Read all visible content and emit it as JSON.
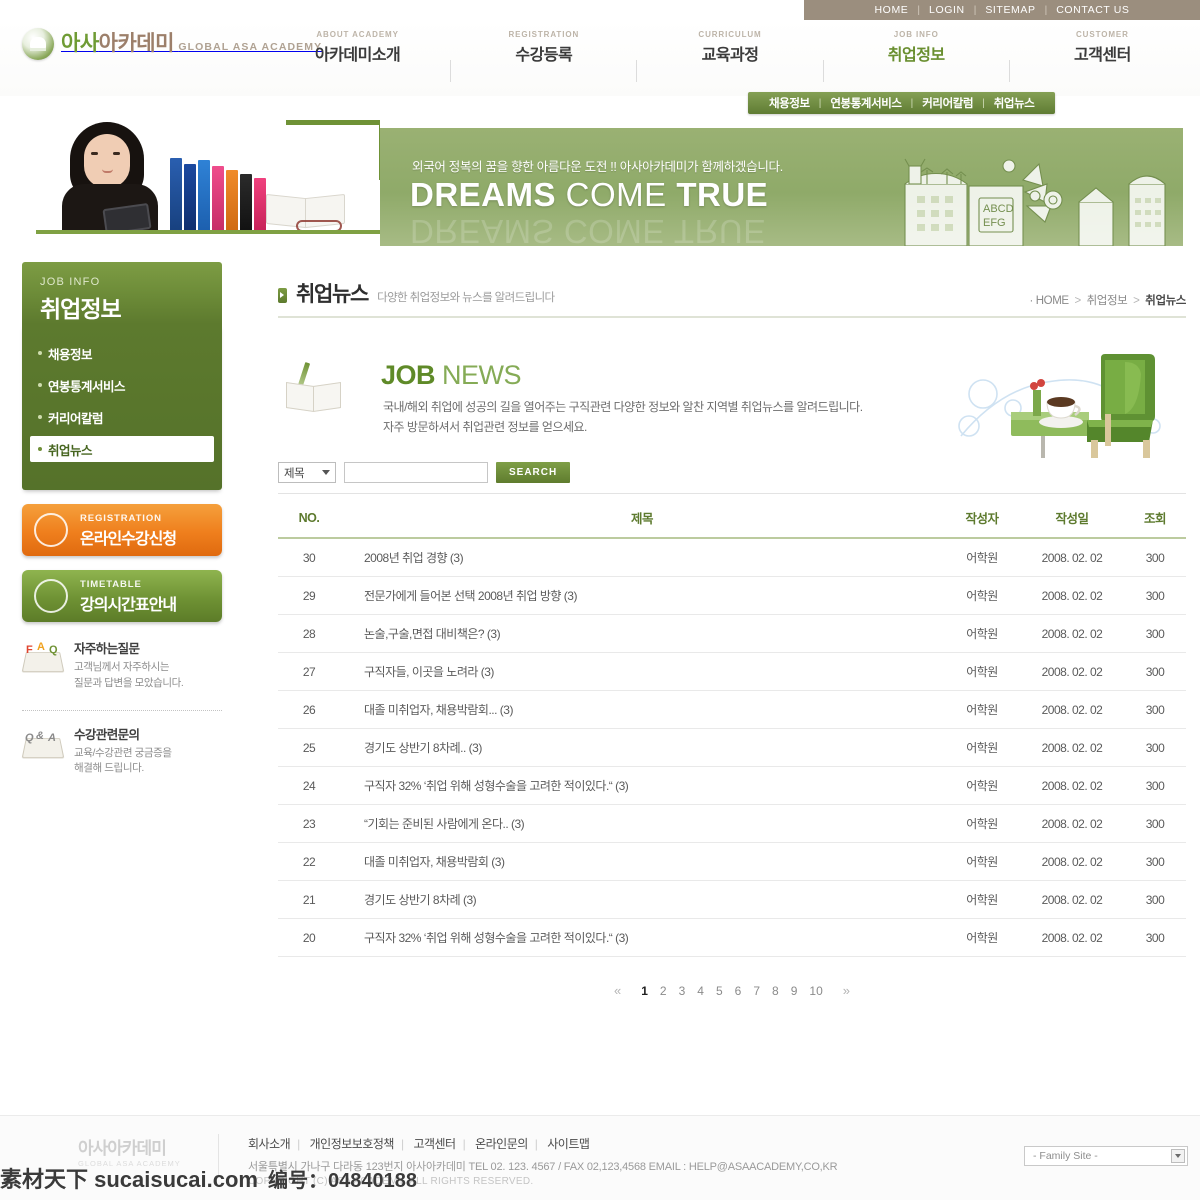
{
  "utility_nav": [
    "HOME",
    "LOGIN",
    "SITEMAP",
    "CONTACT US"
  ],
  "brand": {
    "kr_part1": "아사",
    "kr_part2": "아카데미",
    "en": "GLOBAL ASA ACADEMY",
    "icon": "academy-crest-icon"
  },
  "gnb": [
    {
      "en": "ABOUT ACADEMY",
      "kr": "아카데미소개",
      "active": false
    },
    {
      "en": "REGISTRATION",
      "kr": "수강등록",
      "active": false
    },
    {
      "en": "CURRICULUM",
      "kr": "교육과정",
      "active": false
    },
    {
      "en": "JOB INFO",
      "kr": "취업정보",
      "active": true
    },
    {
      "en": "CUSTOMER",
      "kr": "고객센터",
      "active": false
    }
  ],
  "subnav": [
    "채용정보",
    "연봉통계서비스",
    "커리어칼럼",
    "취업뉴스"
  ],
  "visual": {
    "tagline": "외국어 정복의 꿈을 향한 아름다운 도전 !!  아사아카데미가 함께하겠습니다.",
    "headline_bold": "DREAMS",
    "headline_light": " COME ",
    "headline_bold2": "TRUE",
    "headline_full": "DREAMS COME TRUE",
    "photo_alt": "student-with-books-photo",
    "illustration_alt": "city-books-illustration"
  },
  "sidebar": {
    "en": "JOB INFO",
    "kr": "취업정보",
    "items": [
      {
        "label": "채용정보",
        "active": false
      },
      {
        "label": "연봉통계서비스",
        "active": false
      },
      {
        "label": "커리어칼럼",
        "active": false
      },
      {
        "label": "취업뉴스",
        "active": true
      }
    ],
    "banners": [
      {
        "en": "REGISTRATION",
        "kr": "온라인수강신청",
        "style": "orange",
        "icon": "registration-form-icon"
      },
      {
        "en": "TIMETABLE",
        "kr": "강의시간표안내",
        "style": "green",
        "icon": "open-book-icon"
      }
    ],
    "help": [
      {
        "icon": "faq-icon",
        "title": "자주하는질문",
        "desc_line1": "고객님께서 자주하시는",
        "desc_line2": "질문과 답변을 모았습니다."
      },
      {
        "icon": "qna-icon",
        "title": "수강관련문의",
        "desc_line1": "교육/수강관련 궁금증을",
        "desc_line2": "해결해 드립니다."
      }
    ]
  },
  "page": {
    "title": "취업뉴스",
    "subtitle": "다양한 취업정보와 뉴스를 알려드립니다",
    "breadcrumb": {
      "home": "HOME",
      "section": "취업정보",
      "current": "취업뉴스"
    }
  },
  "jobnews": {
    "title_bold": "JOB",
    "title_light": " NEWS",
    "desc_line1": "국내/해외 취업에 성공의 길을 열어주는 구직관련 다양한 정보와 알찬 지역별 취업뉴스를 알려드립니다.",
    "desc_line2": "자주 방문하셔서 취업관련 정보를 얻으세요.",
    "icon": "book-people-icon",
    "illustration": "green-chair-table-coffee-illustration"
  },
  "search": {
    "select_value": "제목",
    "input_value": "",
    "input_placeholder": "",
    "button_label": "SEARCH"
  },
  "table": {
    "headers": [
      "NO.",
      "제목",
      "작성자",
      "작성일",
      "조회"
    ],
    "rows": [
      {
        "no": "30",
        "subject": "2008년 취업 경향 (3)",
        "writer": "어학원",
        "date": "2008. 02. 02",
        "views": "300"
      },
      {
        "no": "29",
        "subject": "전문가에게 들어본 선택 2008년 취업 방향 (3)",
        "writer": "어학원",
        "date": "2008. 02. 02",
        "views": "300"
      },
      {
        "no": "28",
        "subject": "논술,구술,면접 대비책은? (3)",
        "writer": "어학원",
        "date": "2008. 02. 02",
        "views": "300"
      },
      {
        "no": "27",
        "subject": "구직자들, 이곳을 노려라 (3)",
        "writer": "어학원",
        "date": "2008. 02. 02",
        "views": "300"
      },
      {
        "no": "26",
        "subject": "대졸 미취업자, 채용박람회... (3)",
        "writer": "어학원",
        "date": "2008. 02. 02",
        "views": "300"
      },
      {
        "no": "25",
        "subject": "경기도 상반기 8차례.. (3)",
        "writer": "어학원",
        "date": "2008. 02. 02",
        "views": "300"
      },
      {
        "no": "24",
        "subject": "구직자 32% ‘취업 위해 성형수술을 고려한 적이있다.“ (3)",
        "writer": "어학원",
        "date": "2008. 02. 02",
        "views": "300"
      },
      {
        "no": "23",
        "subject": "“기회는 준비된 사람에게 온다..  (3)",
        "writer": "어학원",
        "date": "2008. 02. 02",
        "views": "300"
      },
      {
        "no": "22",
        "subject": "대졸 미취업자, 채용박람회 (3)",
        "writer": "어학원",
        "date": "2008. 02. 02",
        "views": "300"
      },
      {
        "no": "21",
        "subject": "경기도 상반기 8차례 (3)",
        "writer": "어학원",
        "date": "2008. 02. 02",
        "views": "300"
      },
      {
        "no": "20",
        "subject": "구직자 32% ‘취업 위해 성형수술을 고려한 적이있다.“ (3)",
        "writer": "어학원",
        "date": "2008. 02. 02",
        "views": "300"
      }
    ]
  },
  "pagination": {
    "prev": "«",
    "next": "»",
    "pages": [
      "1",
      "2",
      "3",
      "4",
      "5",
      "6",
      "7",
      "8",
      "9",
      "10"
    ],
    "current": "1"
  },
  "footer": {
    "logo_kr": "아사아카데미",
    "logo_en": "GLOBAL ASA ACADEMY",
    "links": [
      "회사소개",
      "개인정보보호정책",
      "고객센터",
      "온라인문의",
      "사이트맵"
    ],
    "address": "서울특별시 가나구 다라동 123번지 아사아카데미  TEL 02. 123. 4567 / FAX 02,123,4568  EMAIL : HELP@ASAACADEMY,CO,KR",
    "copyright": "COPYRIGHT (C) ASA ACADEMY. ALL RIGHTS RESERVED.",
    "family_site": "- Family Site -"
  },
  "watermark": {
    "text1": "素材天下 sucaisucai.com",
    "text2": "编号：04840188"
  },
  "colors": {
    "brand_green": "#6f9234",
    "dark_green": "#5d7a2e",
    "banner_green": "#96ae6e",
    "util_brown": "#9b8e7e",
    "orange": "#ef7f1d",
    "header_green": "#5d7a2e"
  }
}
